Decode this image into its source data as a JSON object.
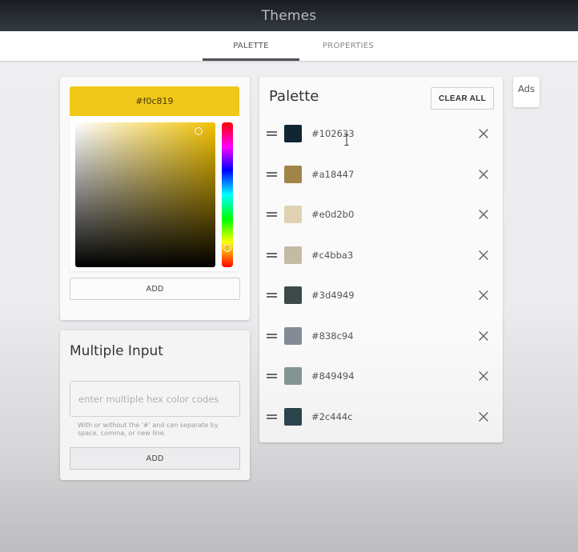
{
  "header": {
    "title": "Themes"
  },
  "tabs": [
    {
      "label": "PALETTE",
      "active": true
    },
    {
      "label": "PROPERTIES",
      "active": false
    }
  ],
  "color_picker": {
    "current_hex": "#f0c819",
    "current_color": "#f0c819",
    "hue_base_color": "#f2c200",
    "saturation": 0.88,
    "brightness": 0.94,
    "hue_degrees": 48,
    "add_label": "ADD"
  },
  "multiple_input": {
    "title": "Multiple Input",
    "placeholder": "enter multiple hex color codes",
    "value": "",
    "hint": "With or without the '#' and can separate by space, comma, or new line.",
    "add_label": "ADD"
  },
  "palette": {
    "title": "Palette",
    "clear_all_label": "CLEAR ALL",
    "items": [
      {
        "hex": "#102633",
        "color": "#102633"
      },
      {
        "hex": "#a18447",
        "color": "#a18447"
      },
      {
        "hex": "#e0d2b0",
        "color": "#e0d2b0"
      },
      {
        "hex": "#c4bba3",
        "color": "#c4bba3"
      },
      {
        "hex": "#3d4949",
        "color": "#3d4949"
      },
      {
        "hex": "#838c94",
        "color": "#838c94"
      },
      {
        "hex": "#849494",
        "color": "#849494"
      },
      {
        "hex": "#2c444c",
        "color": "#2c444c"
      }
    ]
  },
  "ads": {
    "label": "Ads"
  }
}
